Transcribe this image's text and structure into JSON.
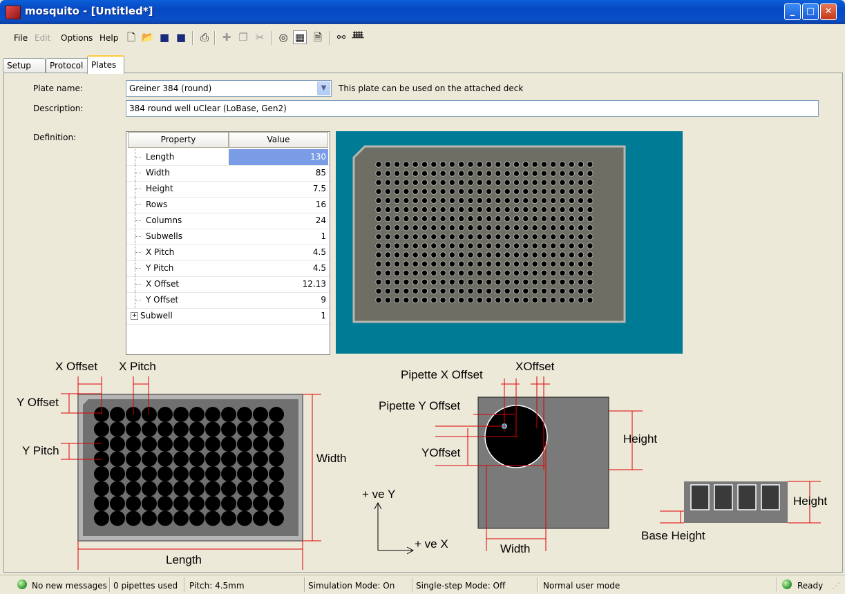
{
  "window": {
    "title": "mosquito - [Untitled*]"
  },
  "menu": {
    "file": "File",
    "edit": "Edit",
    "options": "Options",
    "help": "Help"
  },
  "toolbar_icons": [
    "new-icon",
    "open-icon",
    "save-icon",
    "save-as-icon",
    "print-icon",
    "add-icon",
    "copy-icon",
    "cut-icon",
    "target-icon",
    "plate-icon",
    "document-icon",
    "link-icon",
    "pipettes-icon"
  ],
  "tabs": [
    {
      "label": "Setup"
    },
    {
      "label": "Protocol"
    },
    {
      "label": "Plates"
    }
  ],
  "plate": {
    "name_label": "Plate name:",
    "name_value": "Greiner 384 (round)",
    "deck_note": "This plate can be used on the attached deck",
    "description_label": "Description:",
    "description_value": "384 round well uClear (LoBase, Gen2)",
    "definition_label": "Definition:"
  },
  "grid": {
    "headers": {
      "property": "Property",
      "value": "Value"
    },
    "rows": [
      {
        "property": "Length",
        "value": "130"
      },
      {
        "property": "Width",
        "value": "85"
      },
      {
        "property": "Height",
        "value": "7.5"
      },
      {
        "property": "Rows",
        "value": "16"
      },
      {
        "property": "Columns",
        "value": "24"
      },
      {
        "property": "Subwells",
        "value": "1"
      },
      {
        "property": "X Pitch",
        "value": "4.5"
      },
      {
        "property": "Y Pitch",
        "value": "4.5"
      },
      {
        "property": "X Offset",
        "value": "12.13"
      },
      {
        "property": "Y Offset",
        "value": "9"
      },
      {
        "property": "Subwell",
        "value": "1"
      }
    ]
  },
  "diagram": {
    "x_offset": "X Offset",
    "x_pitch": "X Pitch",
    "y_offset": "Y Offset",
    "y_pitch": "Y Pitch",
    "width": "Width",
    "length": "Length",
    "pipette_x_offset": "Pipette X Offset",
    "xoffset": "XOffset",
    "pipette_y_offset": "Pipette Y Offset",
    "yoffset": "YOffset",
    "height": "Height",
    "well_width": "Width",
    "plus_y": "+ ve Y",
    "plus_x": "+ ve X",
    "side_height": "Height",
    "base_height": "Base Height"
  },
  "status": {
    "messages": "No new messages",
    "pipettes": "0 pipettes used",
    "pitch": "Pitch: 4.5mm",
    "simulation": "Simulation Mode: On",
    "single_step": "Single-step Mode: Off",
    "user_mode": "Normal user mode",
    "ready": "Ready"
  },
  "colors": {
    "preview_bg": "#007B96",
    "plate_gray": "#6E6E64",
    "selection": "#7A9CE6",
    "guide_red": "#E00000"
  }
}
